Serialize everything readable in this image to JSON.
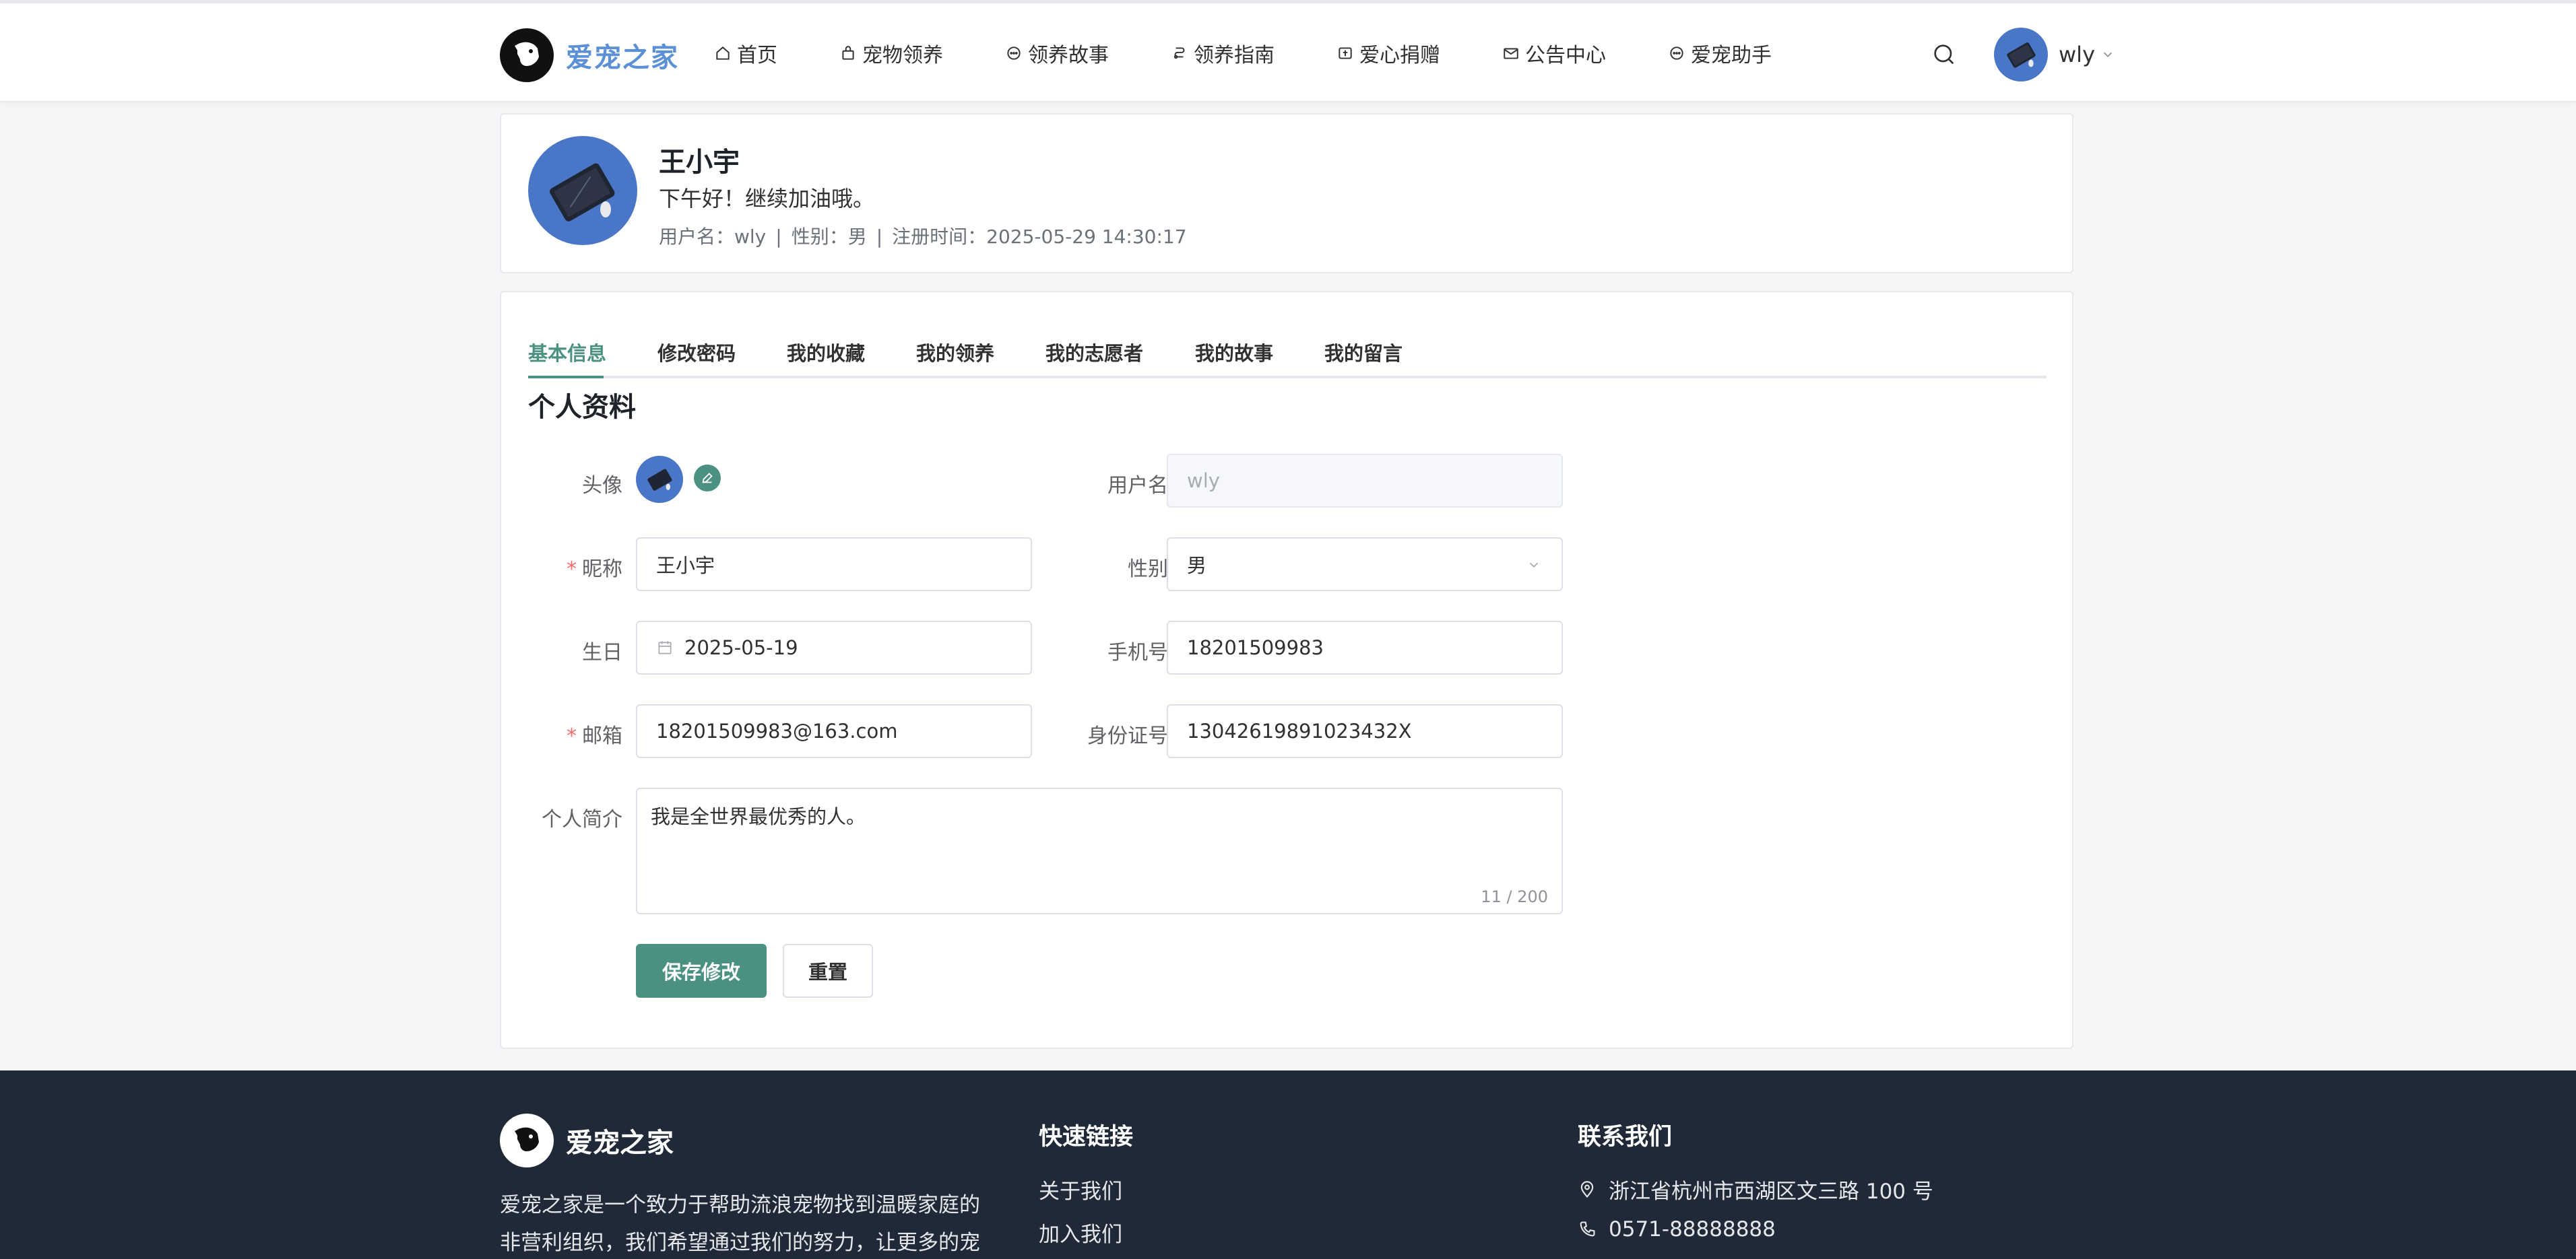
{
  "brand": {
    "name": "爱宠之家",
    "accent": "#4a9182",
    "logo_color": "#5b8fd6"
  },
  "nav": {
    "items": [
      {
        "label": "首页",
        "icon": "home-icon"
      },
      {
        "label": "宠物领养",
        "icon": "bag-icon"
      },
      {
        "label": "领养故事",
        "icon": "chat-icon"
      },
      {
        "label": "领养指南",
        "icon": "guide-icon"
      },
      {
        "label": "爱心捐赠",
        "icon": "donate-icon"
      },
      {
        "label": "公告中心",
        "icon": "mail-icon"
      },
      {
        "label": "爱宠助手",
        "icon": "chat-icon"
      }
    ],
    "user": "wly"
  },
  "profile": {
    "name": "王小宇",
    "greeting": "下午好！继续加油哦。",
    "username_label": "用户名：wly",
    "gender_label": "性别：男",
    "register_label": "注册时间：2025-05-29 14:30:17",
    "separator": "|"
  },
  "tabs": [
    "基本信息",
    "修改密码",
    "我的收藏",
    "我的领养",
    "我的志愿者",
    "我的故事",
    "我的留言"
  ],
  "form": {
    "title": "个人资料",
    "avatar_label": "头像",
    "username_label": "用户名",
    "username_value": "wly",
    "nickname_label": "昵称",
    "nickname_value": "王小宇",
    "gender_label": "性别",
    "gender_value": "男",
    "birthday_label": "生日",
    "birthday_value": "2025-05-19",
    "phone_label": "手机号",
    "phone_value": "18201509983",
    "email_label": "邮箱",
    "email_value": "18201509983@163.com",
    "idcard_label": "身份证号",
    "idcard_value": "13042619891023432X",
    "bio_label": "个人简介",
    "bio_value": "我是全世界最优秀的人。",
    "bio_counter": "11 / 200",
    "required_mark": "*",
    "save_label": "保存修改",
    "reset_label": "重置"
  },
  "footer": {
    "brand": "爱宠之家",
    "description": "爱宠之家是一个致力于帮助流浪宠物找到温暖家庭的非营利组织，我们希望通过我们的努力，让更多的宠",
    "links_title": "快速链接",
    "links": [
      "关于我们",
      "加入我们"
    ],
    "contact_title": "联系我们",
    "address": "浙江省杭州市西湖区文三路 100 号",
    "phone": "0571-88888888"
  }
}
